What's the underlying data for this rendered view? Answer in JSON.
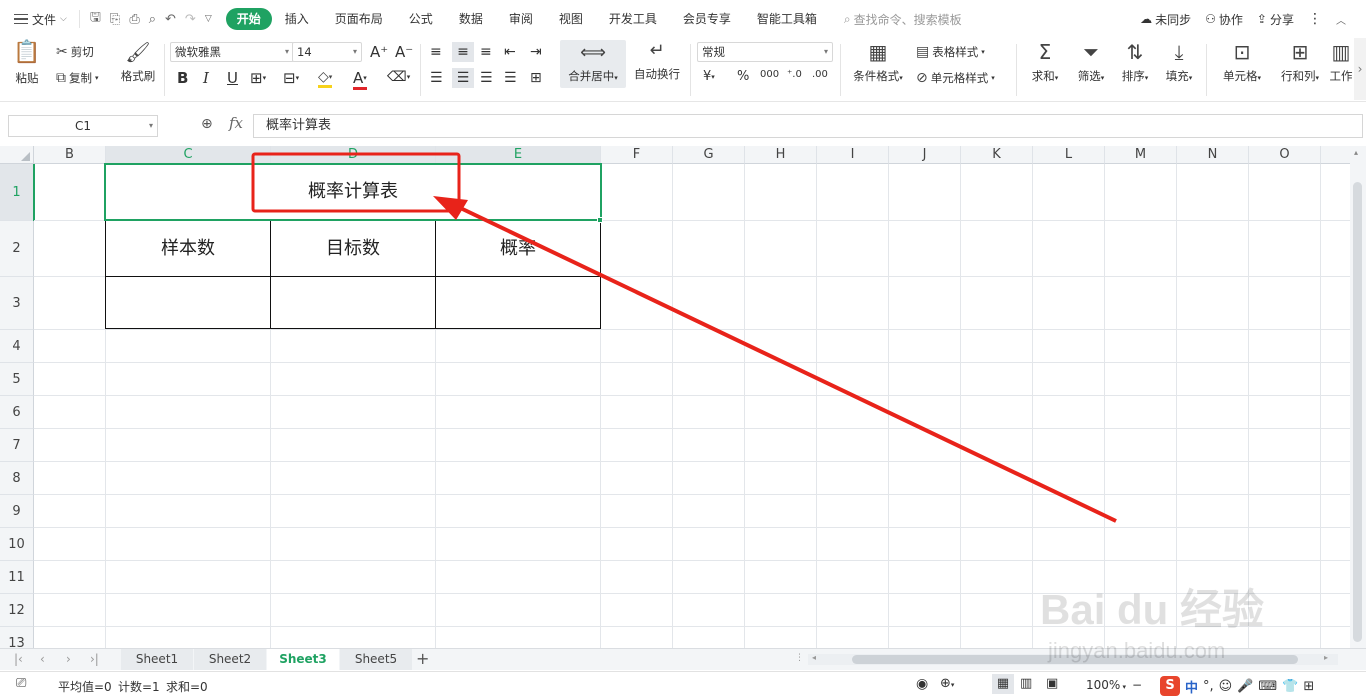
{
  "menu": {
    "file_label": "文件",
    "tabs": [
      "开始",
      "插入",
      "页面布局",
      "公式",
      "数据",
      "审阅",
      "视图",
      "开发工具",
      "会员专享",
      "智能工具箱"
    ],
    "active_tab": "开始",
    "search_placeholder": "查找命令、搜索模板",
    "sync_label": "未同步",
    "collab_label": "协作",
    "share_label": "分享"
  },
  "ribbon": {
    "paste": "粘贴",
    "cut": "剪切",
    "copy": "复制",
    "format_painter": "格式刷",
    "font_name": "微软雅黑",
    "font_size": "14",
    "merge_center": "合并居中",
    "wrap_text": "自动换行",
    "number_format": "常规",
    "cond_format": "条件格式",
    "table_style": "表格样式",
    "cell_style": "单元格样式",
    "sum": "求和",
    "filter": "筛选",
    "sort": "排序",
    "fill": "填充",
    "cell": "单元格",
    "row_col": "行和列",
    "worksheet": "工作"
  },
  "formula_bar": {
    "name_box": "C1",
    "content": "概率计算表"
  },
  "grid": {
    "columns": [
      "B",
      "C",
      "D",
      "E",
      "F",
      "G",
      "H",
      "I",
      "J",
      "K",
      "L",
      "M",
      "N",
      "O"
    ],
    "selected_columns": [
      "C",
      "D",
      "E"
    ],
    "rows": [
      "1",
      "2",
      "3",
      "4",
      "5",
      "6",
      "7",
      "8",
      "9",
      "10",
      "11",
      "12",
      "13"
    ],
    "selected_row": "1",
    "title_cell": "概率计算表",
    "headers": [
      "样本数",
      "目标数",
      "概率"
    ]
  },
  "sheets": {
    "tabs": [
      "Sheet1",
      "Sheet2",
      "Sheet3",
      "Sheet5"
    ],
    "active": "Sheet3"
  },
  "status": {
    "average": "平均值=0",
    "count": "计数=1",
    "sum": "求和=0",
    "zoom": "100%",
    "input_mode": "中"
  },
  "colors": {
    "accent": "#1fa262",
    "annotation_red": "#e8231a"
  },
  "watermark": {
    "brand": "Bai du 经验",
    "url": "jingyan.baidu.com"
  }
}
